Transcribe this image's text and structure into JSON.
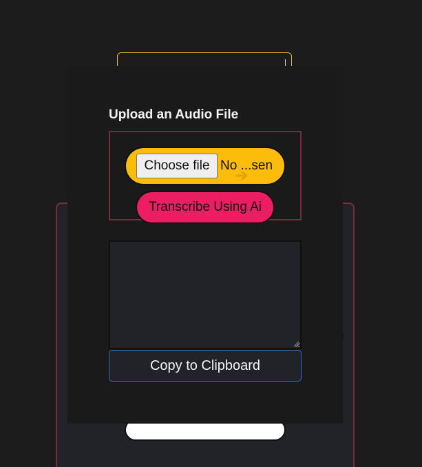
{
  "upload": {
    "title": "Upload an Audio File",
    "choose_file_label": "Choose file",
    "file_status": "No ...sen",
    "transcribe_label": "Transcribe Using Ai"
  },
  "transcript": {
    "value": ""
  },
  "copy_label": "Copy to Clipboard",
  "colors": {
    "page_background": "#1c1c1d",
    "modal_background": "#1a1a1a",
    "file_pill": "#fbbc0b",
    "transcribe_button": "#ec1e63",
    "upload_border": "#7c2b3f",
    "copy_border": "#2f6eb8"
  },
  "icons": {
    "cursor": "arrow-cursor-icon",
    "resize": "resize-grip-icon"
  }
}
